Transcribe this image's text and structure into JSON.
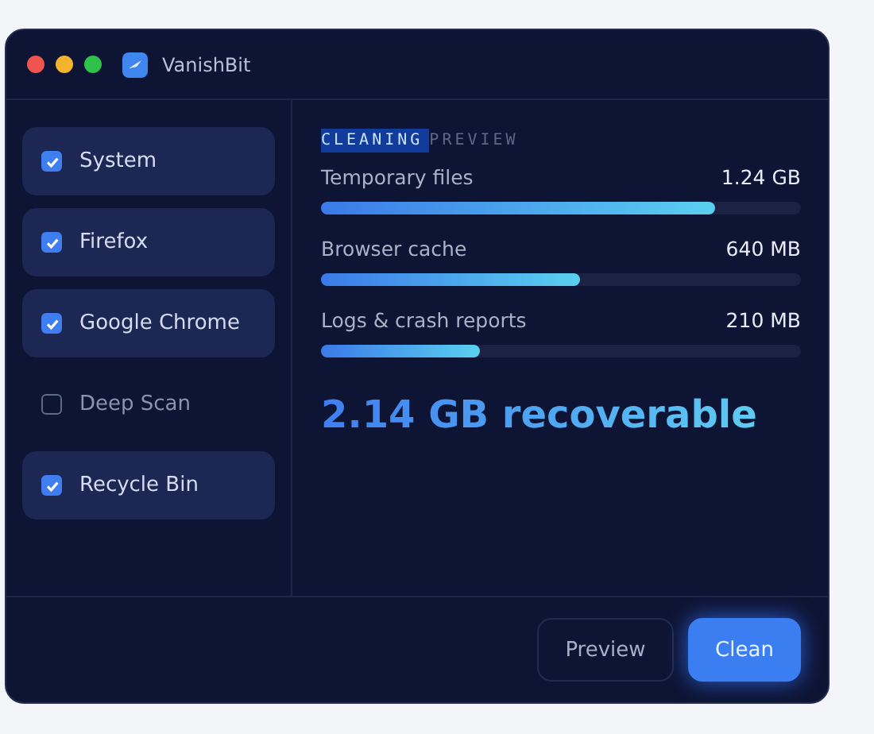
{
  "window": {
    "title": "VanishBit"
  },
  "sidebar": {
    "items": [
      {
        "label": "System",
        "checked": true
      },
      {
        "label": "Firefox",
        "checked": true
      },
      {
        "label": "Google Chrome",
        "checked": true
      },
      {
        "label": "Deep Scan",
        "checked": false
      },
      {
        "label": "Recycle Bin",
        "checked": true
      }
    ]
  },
  "heading": [
    {
      "text": "CLEANING",
      "selected": true
    },
    {
      "text": "PREVIEW",
      "selected": false
    }
  ],
  "rows": [
    {
      "label": "Temporary files",
      "size": "1.24 GB",
      "level": 0.82
    },
    {
      "label": "Browser cache",
      "size": "640 MB",
      "level": 0.54
    },
    {
      "label": "Logs & crash reports",
      "size": "210 MB",
      "level": 0.33
    }
  ],
  "total": "2.14 GB recoverable",
  "buttons": [
    {
      "label": "Preview",
      "kind": "secondary"
    },
    {
      "label": "Clean",
      "kind": "primary"
    }
  ]
}
